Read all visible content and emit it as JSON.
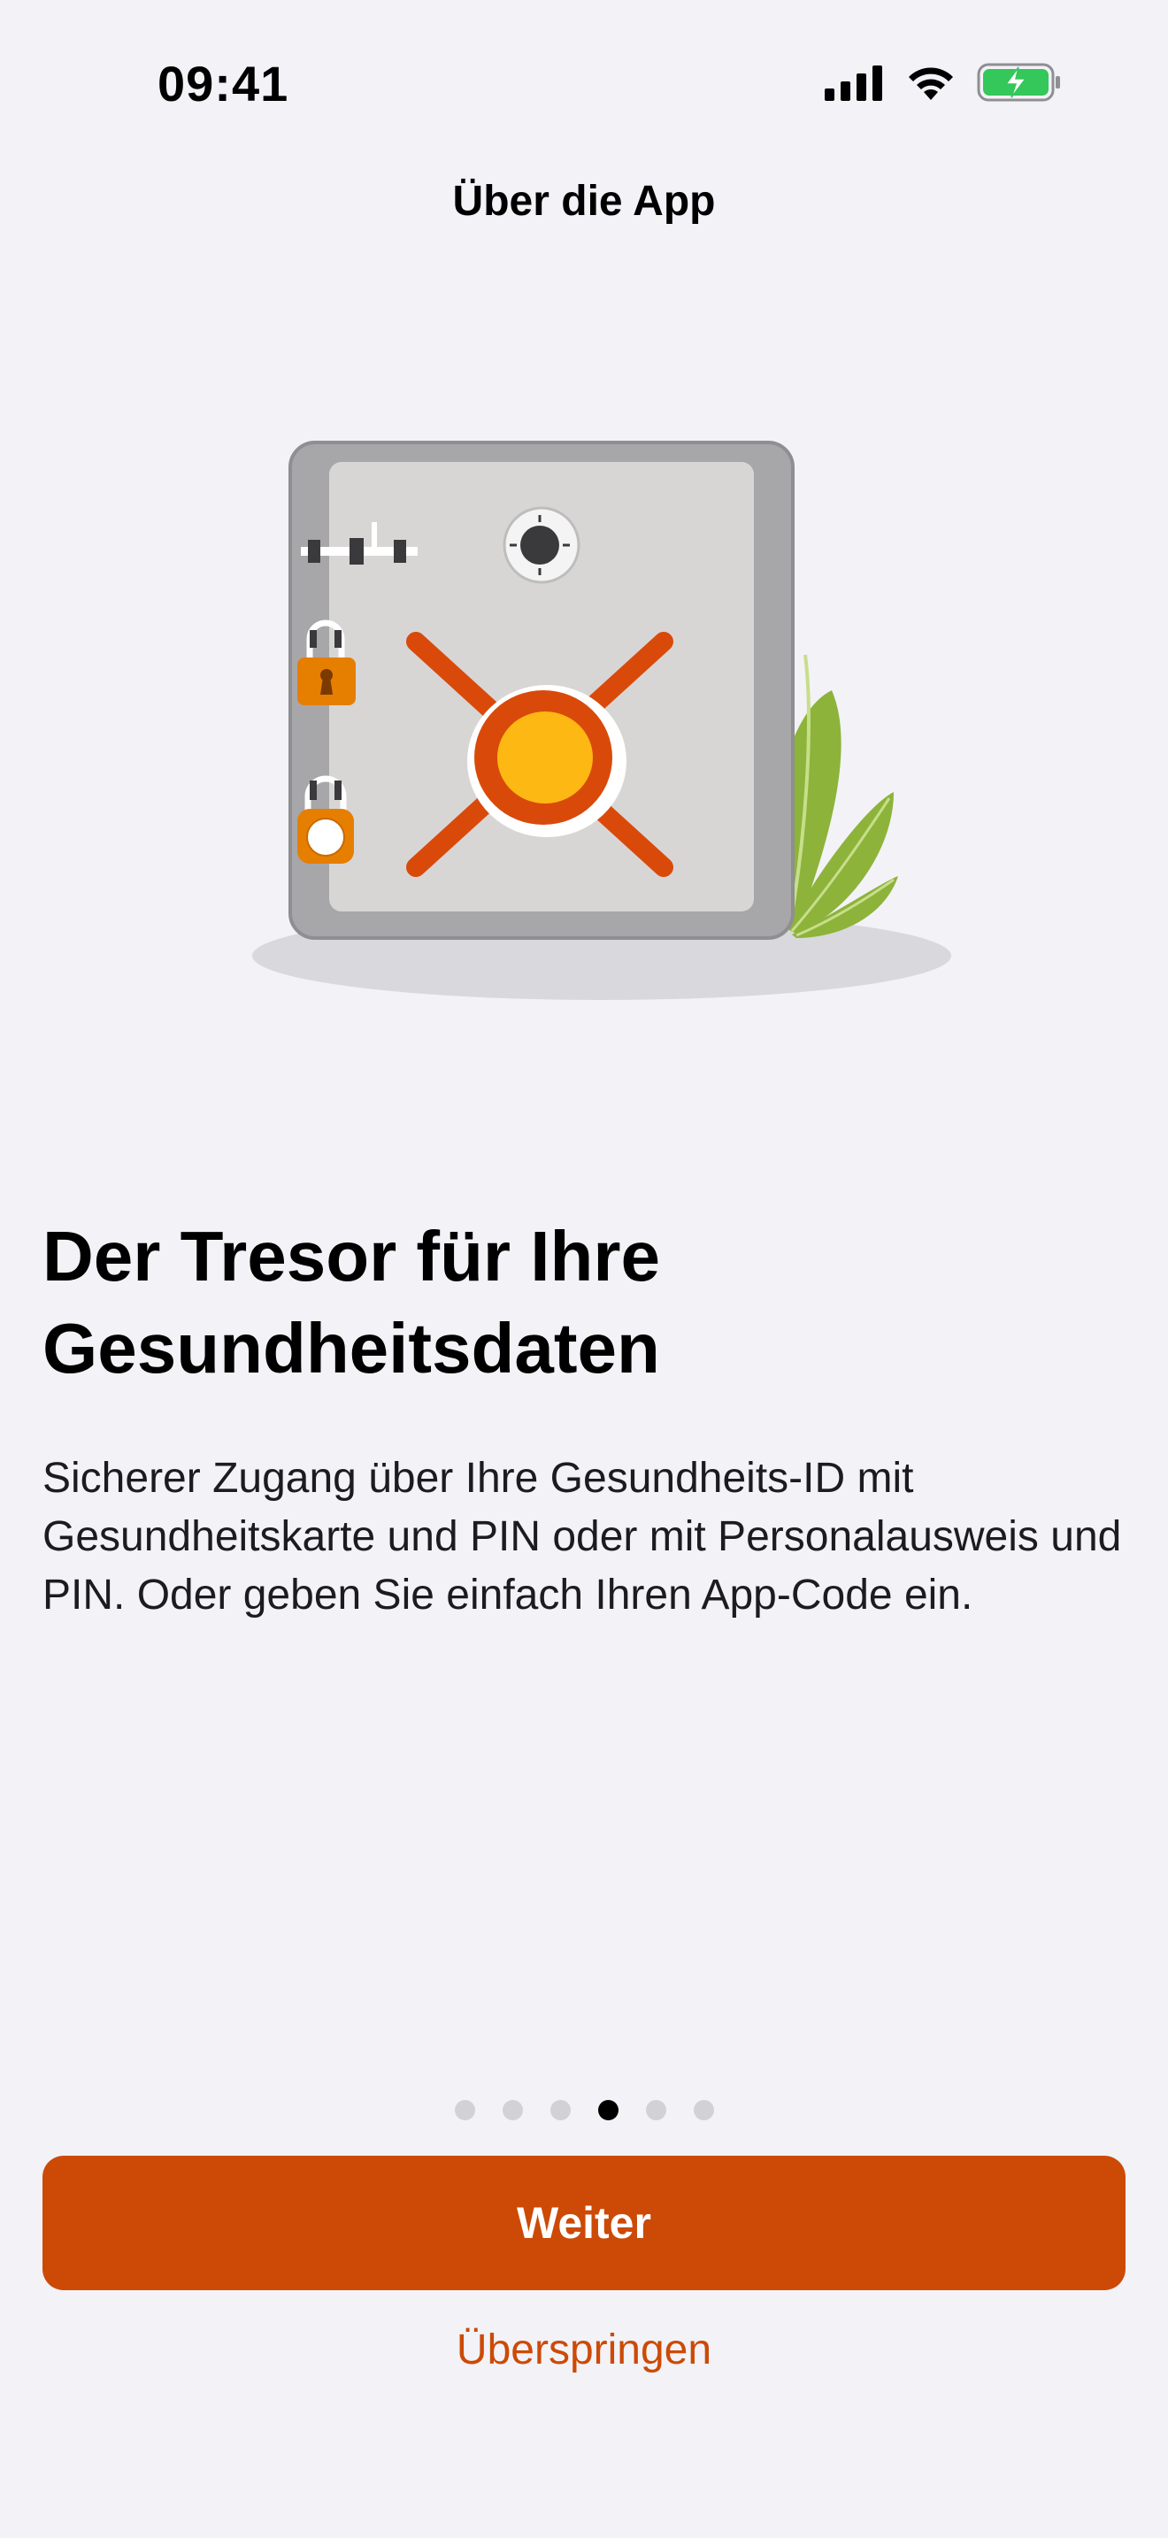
{
  "status_bar": {
    "time": "09:41"
  },
  "nav": {
    "title": "Über die App"
  },
  "illustration": {
    "name": "safe-illustration"
  },
  "content": {
    "heading": "Der Tresor für Ihre Gesundheitsdaten",
    "body": "Sicherer Zugang über Ihre Gesundheits-ID mit Gesundheitskarte und PIN oder mit Personalausweis und PIN. Oder geben Sie einfach Ihren App-Code ein."
  },
  "pagination": {
    "total": 6,
    "current": 4
  },
  "actions": {
    "primary_label": "Weiter",
    "secondary_label": "Überspringen"
  },
  "colors": {
    "accent": "#CC4A06",
    "background": "#F2F2F7",
    "battery": "#34C759"
  },
  "icons": [
    "signal-icon",
    "wifi-icon",
    "battery-charging-icon"
  ]
}
